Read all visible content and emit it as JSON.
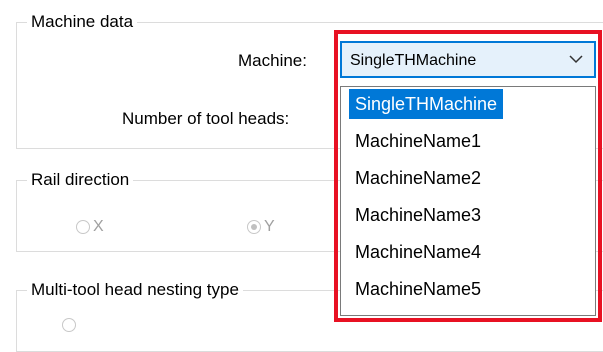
{
  "machine_data": {
    "legend": "Machine data",
    "machine_label": "Machine:",
    "tool_heads_label": "Number of tool heads:",
    "selected_machine": "SingleTHMachine"
  },
  "dropdown": {
    "options": [
      "SingleTHMachine",
      "MachineName1",
      "MachineName2",
      "MachineName3",
      "MachineName4",
      "MachineName5"
    ],
    "selected_index": 0
  },
  "rail_direction": {
    "legend": "Rail direction",
    "option_x": "X",
    "option_y": "Y",
    "selected": "Y"
  },
  "nesting": {
    "legend": "Multi-tool head nesting type"
  },
  "colors": {
    "highlight": "#e81123",
    "accent": "#0078d7",
    "combo_bg": "#e5f1fb"
  }
}
